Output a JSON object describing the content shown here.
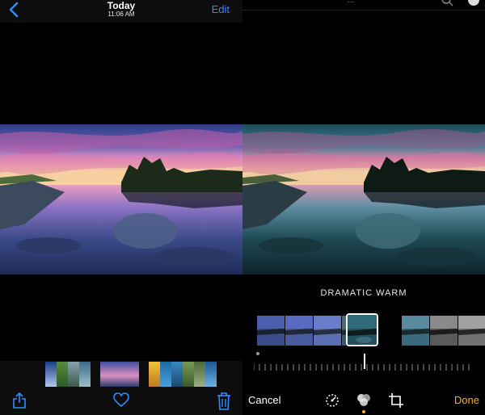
{
  "left": {
    "nav": {
      "title": "Today",
      "time": "11:06 AM",
      "edit_label": "Edit"
    }
  },
  "right": {
    "top": {
      "partial_text": "..."
    },
    "filter_name": "DRAMATIC WARM",
    "cancel_label": "Cancel",
    "done_label": "Done",
    "accent": "#f5b21a"
  },
  "colors": {
    "link_blue": "#2f8cff"
  },
  "icons": [
    "chevron-left-icon",
    "share-icon",
    "heart-icon",
    "trash-icon",
    "adjust-dial-icon",
    "filters-icon",
    "crop-icon",
    "search-icon"
  ]
}
